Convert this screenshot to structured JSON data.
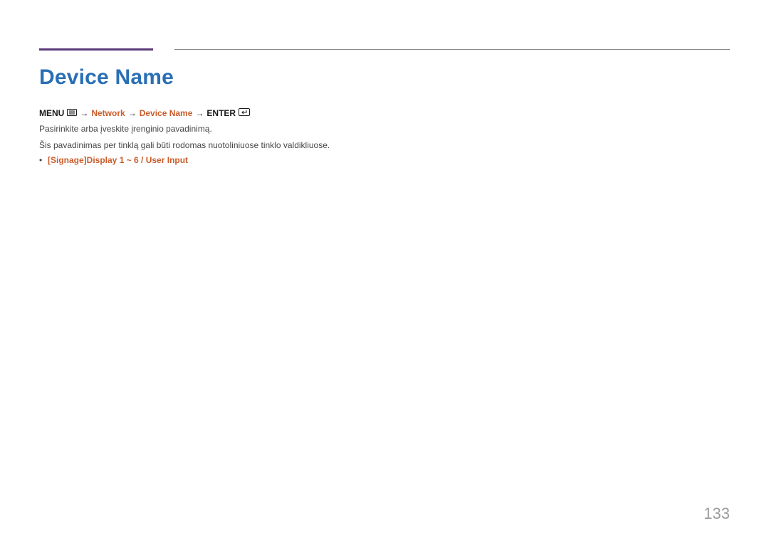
{
  "title": "Device Name",
  "path": {
    "menu_label": "MENU",
    "arrow": "→",
    "seg1": "Network",
    "seg2": "Device Name",
    "enter_label": "ENTER"
  },
  "body": {
    "line1": "Pasirinkite arba įveskite įrenginio pavadinimą.",
    "line2": "Šis pavadinimas per tinklą gali būti rodomas nuotoliniuose tinklo valdikliuose."
  },
  "bullet": "[Signage]Display 1 ~ 6 / User Input",
  "page_number": "133"
}
